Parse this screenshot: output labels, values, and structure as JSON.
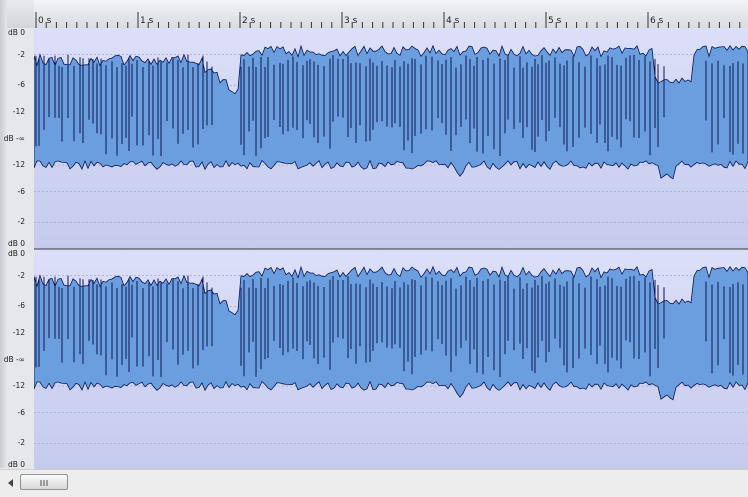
{
  "ruler": {
    "seconds": [
      "0 s",
      "1 s",
      "2 s",
      "3 s",
      "4 s",
      "5 s",
      "6 s"
    ]
  },
  "channels": [
    {
      "db_labels": [
        "dB 0",
        "-2",
        "-6",
        "-12",
        "dB -∞",
        "-12",
        "-6",
        "-2",
        "dB 0"
      ]
    },
    {
      "db_labels": [
        "dB 0",
        "-2",
        "-6",
        "-12",
        "dB -∞",
        "-12",
        "-6",
        "-2",
        "dB 0"
      ]
    }
  ],
  "colors": {
    "background": "#dcdff8",
    "background_dark": "#c6cbee",
    "waveform_fill": "#6a9edf",
    "waveform_stroke": "#0c1650"
  },
  "scrollbar": {
    "left_arrow_icon": "triangle-left-icon",
    "thumb_grip_icon": "grip-lines-icon"
  }
}
